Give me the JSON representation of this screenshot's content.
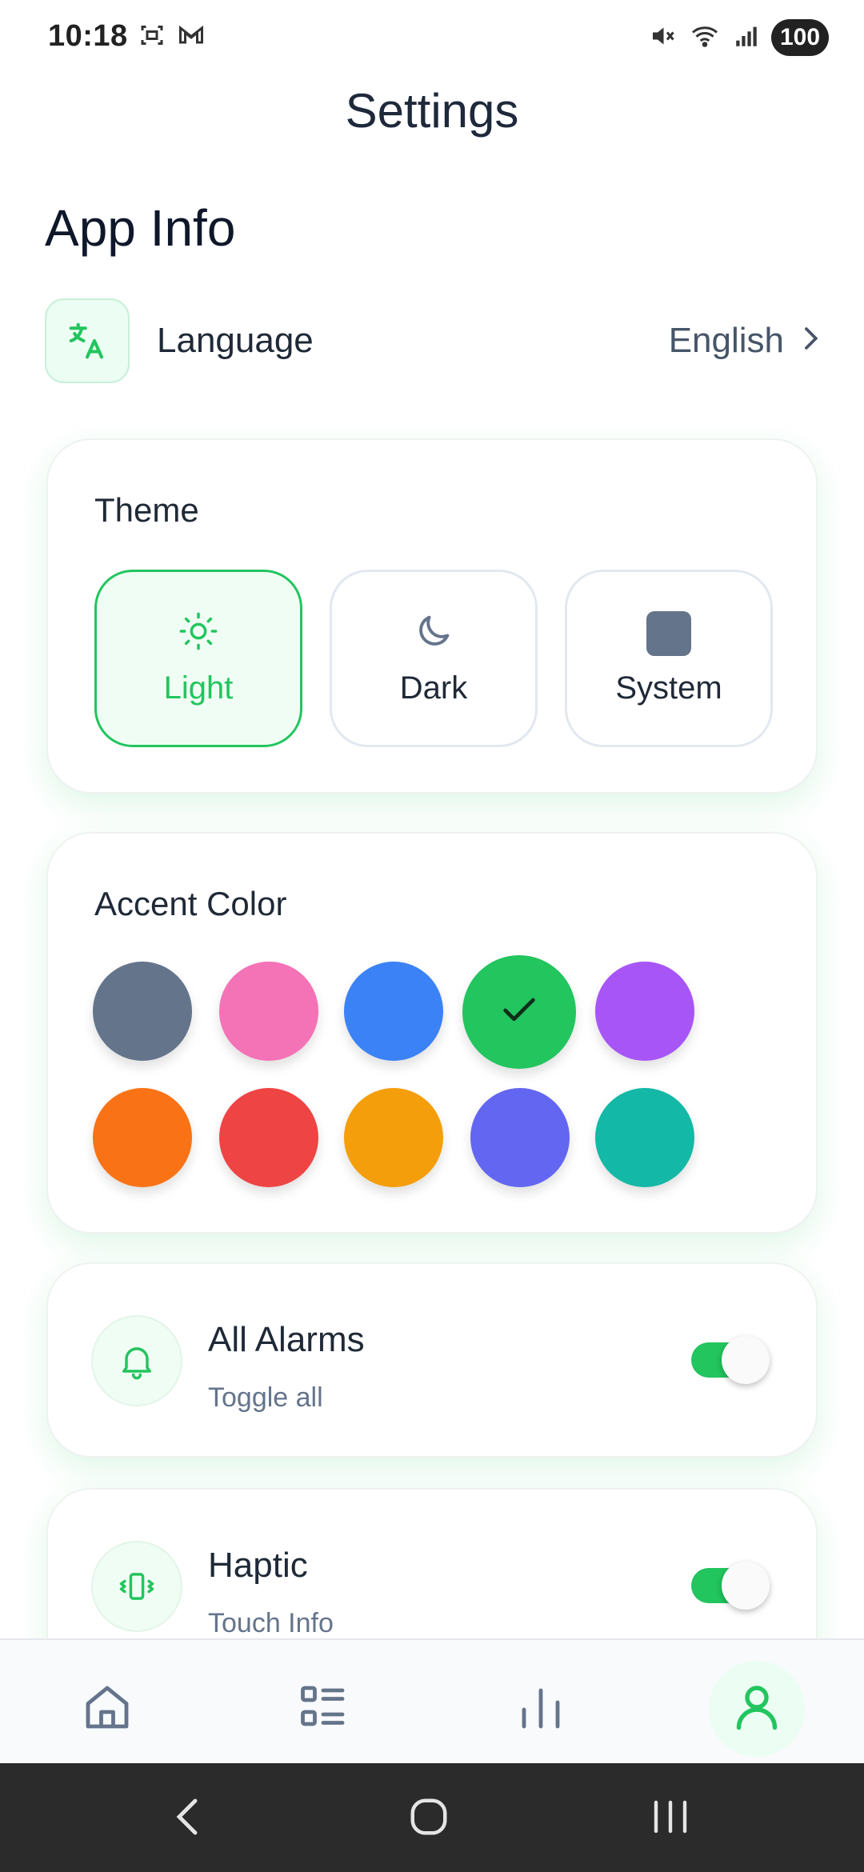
{
  "status_bar": {
    "time": "10:18",
    "battery": "100",
    "icons": [
      "screenshot-icon",
      "gmail-icon",
      "mute-icon",
      "wifi-icon",
      "signal-icon"
    ]
  },
  "header": {
    "title": "Settings"
  },
  "section": {
    "title": "App Info"
  },
  "language": {
    "label": "Language",
    "value": "English",
    "icon": "translate-icon"
  },
  "theme": {
    "title": "Theme",
    "options": [
      {
        "label": "Light",
        "icon": "sun-icon",
        "selected": true
      },
      {
        "label": "Dark",
        "icon": "moon-icon",
        "selected": false
      },
      {
        "label": "System",
        "icon": "system-icon",
        "selected": false
      }
    ]
  },
  "accent": {
    "title": "Accent Color",
    "colors": [
      "#64748b",
      "#f472b6",
      "#3b82f6",
      "#22c55e",
      "#a855f7",
      "#f97316",
      "#ef4444",
      "#f59e0b",
      "#6366f1",
      "#14b8a6"
    ],
    "selected_color": "#22c55e"
  },
  "alarms": {
    "title": "All Alarms",
    "subtitle": "Toggle all",
    "enabled": true,
    "icon": "bell-icon"
  },
  "haptic": {
    "title": "Haptic",
    "subtitle": "Touch Info",
    "enabled": true,
    "icon": "vibrate-icon"
  },
  "bottom_nav": {
    "items": [
      {
        "icon": "home-icon",
        "active": false
      },
      {
        "icon": "list-icon",
        "active": false
      },
      {
        "icon": "chart-icon",
        "active": false
      },
      {
        "icon": "profile-icon",
        "active": true
      }
    ]
  },
  "colors": {
    "accent": "#22c55e",
    "nav_active_bg": "#ecfdf3",
    "system_nav_bg": "#2b2b2b"
  }
}
